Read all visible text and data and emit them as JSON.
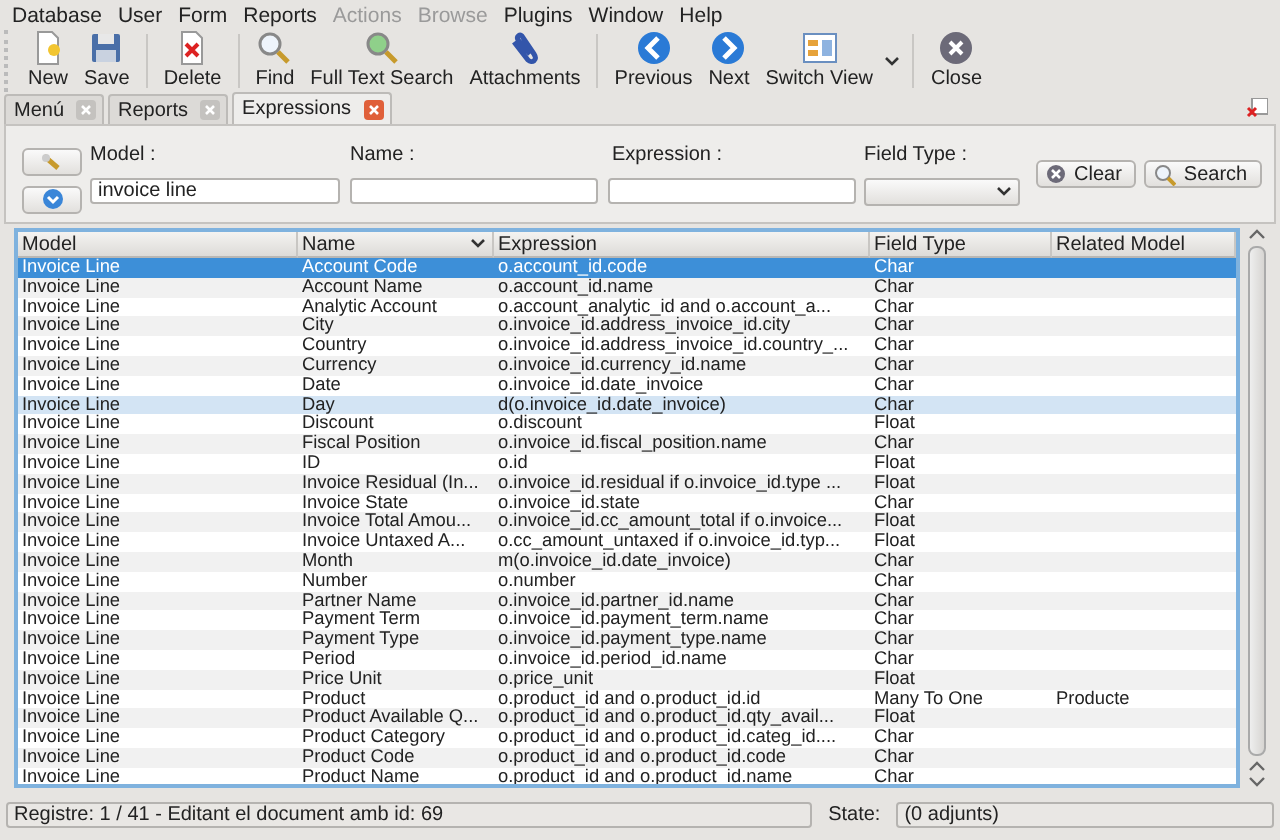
{
  "menu": [
    {
      "label": "Database",
      "disabled": false
    },
    {
      "label": "User",
      "disabled": false
    },
    {
      "label": "Form",
      "disabled": false
    },
    {
      "label": "Reports",
      "disabled": false
    },
    {
      "label": "Actions",
      "disabled": true
    },
    {
      "label": "Browse",
      "disabled": true
    },
    {
      "label": "Plugins",
      "disabled": false
    },
    {
      "label": "Window",
      "disabled": false
    },
    {
      "label": "Help",
      "disabled": false
    }
  ],
  "toolbar": [
    {
      "label": "New"
    },
    {
      "label": "Save"
    },
    {
      "label": "Delete"
    },
    {
      "label": "Find"
    },
    {
      "label": "Full Text Search"
    },
    {
      "label": "Attachments"
    },
    {
      "label": "Previous"
    },
    {
      "label": "Next"
    },
    {
      "label": "Switch View",
      "dropdown": true
    },
    {
      "label": "Close"
    }
  ],
  "tabs": [
    {
      "label": "Menú",
      "selected": false
    },
    {
      "label": "Reports",
      "selected": false
    },
    {
      "label": "Expressions",
      "selected": true
    }
  ],
  "search": {
    "fields": [
      {
        "label": "Model :",
        "value": "invoice line"
      },
      {
        "label": "Name :"
      },
      {
        "label": "Expression :"
      }
    ],
    "field_type": {
      "label": "Field Type :"
    },
    "buttons": [
      "Clear",
      "Search"
    ]
  },
  "table": {
    "columns": [
      {
        "label": "Model",
        "sorted": false
      },
      {
        "label": "Name",
        "sorted": true
      },
      {
        "label": "Expression",
        "sorted": false
      },
      {
        "label": "Field Type",
        "sorted": false
      },
      {
        "label": "Related Model",
        "sorted": false
      }
    ],
    "rows": [
      {
        "cells": [
          "Invoice Line",
          "Account Code",
          "o.account_id.code",
          "Char"
        ],
        "selected": true,
        "highlighted": false
      },
      {
        "cells": [
          "Invoice Line",
          "Account Name",
          "o.account_id.name",
          "Char"
        ],
        "selected": false,
        "highlighted": false
      },
      {
        "cells": [
          "Invoice Line",
          "Analytic Account",
          "o.account_analytic_id and o.account_a...",
          "Char"
        ],
        "selected": false,
        "highlighted": false
      },
      {
        "cells": [
          "Invoice Line",
          "City",
          "o.invoice_id.address_invoice_id.city",
          "Char"
        ],
        "selected": false,
        "highlighted": false
      },
      {
        "cells": [
          "Invoice Line",
          "Country",
          "o.invoice_id.address_invoice_id.country_...",
          "Char"
        ],
        "selected": false,
        "highlighted": false
      },
      {
        "cells": [
          "Invoice Line",
          "Currency",
          "o.invoice_id.currency_id.name",
          "Char"
        ],
        "selected": false,
        "highlighted": false
      },
      {
        "cells": [
          "Invoice Line",
          "Date",
          "o.invoice_id.date_invoice",
          "Char"
        ],
        "selected": false,
        "highlighted": false
      },
      {
        "cells": [
          "Invoice Line",
          "Day",
          "d(o.invoice_id.date_invoice)",
          "Char"
        ],
        "selected": false,
        "highlighted": true
      },
      {
        "cells": [
          "Invoice Line",
          "Discount",
          "o.discount",
          "Float"
        ],
        "selected": false,
        "highlighted": false
      },
      {
        "cells": [
          "Invoice Line",
          "Fiscal Position",
          "o.invoice_id.fiscal_position.name",
          "Char"
        ],
        "selected": false,
        "highlighted": false
      },
      {
        "cells": [
          "Invoice Line",
          "ID",
          "o.id",
          "Float"
        ],
        "selected": false,
        "highlighted": false
      },
      {
        "cells": [
          "Invoice Line",
          "Invoice Residual (In...",
          "o.invoice_id.residual if o.invoice_id.type ...",
          "Float"
        ],
        "selected": false,
        "highlighted": false
      },
      {
        "cells": [
          "Invoice Line",
          "Invoice State",
          "o.invoice_id.state",
          "Char"
        ],
        "selected": false,
        "highlighted": false
      },
      {
        "cells": [
          "Invoice Line",
          "Invoice Total Amou...",
          "o.invoice_id.cc_amount_total if o.invoice...",
          "Float"
        ],
        "selected": false,
        "highlighted": false
      },
      {
        "cells": [
          "Invoice Line",
          "Invoice Untaxed A...",
          "o.cc_amount_untaxed if o.invoice_id.typ...",
          "Float"
        ],
        "selected": false,
        "highlighted": false
      },
      {
        "cells": [
          "Invoice Line",
          "Month",
          "m(o.invoice_id.date_invoice)",
          "Char"
        ],
        "selected": false,
        "highlighted": false
      },
      {
        "cells": [
          "Invoice Line",
          "Number",
          "o.number",
          "Char"
        ],
        "selected": false,
        "highlighted": false
      },
      {
        "cells": [
          "Invoice Line",
          "Partner Name",
          "o.invoice_id.partner_id.name",
          "Char"
        ],
        "selected": false,
        "highlighted": false
      },
      {
        "cells": [
          "Invoice Line",
          "Payment Term",
          "o.invoice_id.payment_term.name",
          "Char"
        ],
        "selected": false,
        "highlighted": false
      },
      {
        "cells": [
          "Invoice Line",
          "Payment Type",
          "o.invoice_id.payment_type.name",
          "Char"
        ],
        "selected": false,
        "highlighted": false
      },
      {
        "cells": [
          "Invoice Line",
          "Period",
          "o.invoice_id.period_id.name",
          "Char"
        ],
        "selected": false,
        "highlighted": false
      },
      {
        "cells": [
          "Invoice Line",
          "Price Unit",
          "o.price_unit",
          "Float"
        ],
        "selected": false,
        "highlighted": false
      },
      {
        "cells": [
          "Invoice Line",
          "Product",
          "o.product_id and o.product_id.id",
          "Many To One",
          "Producte"
        ],
        "selected": false,
        "highlighted": false
      },
      {
        "cells": [
          "Invoice Line",
          "Product Available Q...",
          "o.product_id and o.product_id.qty_avail...",
          "Float"
        ],
        "selected": false,
        "highlighted": false
      },
      {
        "cells": [
          "Invoice Line",
          "Product Category",
          "o.product_id and o.product_id.categ_id....",
          "Char"
        ],
        "selected": false,
        "highlighted": false
      },
      {
        "cells": [
          "Invoice Line",
          "Product Code",
          "o.product_id and o.product_id.code",
          "Char"
        ],
        "selected": false,
        "highlighted": false
      },
      {
        "cells": [
          "Invoice Line",
          "Product Name",
          "o.product_id and o.product_id.name",
          "Char"
        ],
        "selected": false,
        "highlighted": false
      }
    ]
  },
  "status_bar": {
    "text": "Registre: 1 / 41 - Editant el document amb id: 69",
    "state_label": "State:",
    "state_value": "(0 adjunts)"
  }
}
